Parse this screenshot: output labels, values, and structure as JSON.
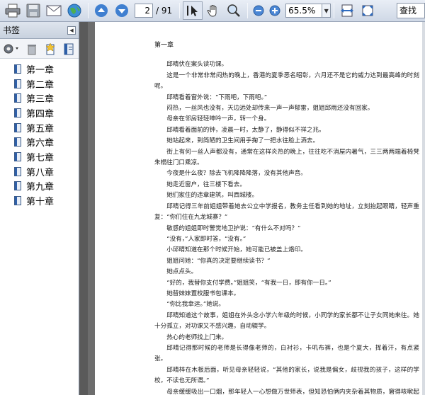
{
  "toolbar": {
    "page_current": "2",
    "page_total": "/ 91",
    "zoom": "65.5%",
    "search_label": "查找",
    "icons": [
      "printer-icon",
      "save-icon",
      "email-icon",
      "globe-icon",
      "page-up-icon",
      "page-down-icon",
      "select-tool-icon",
      "hand-tool-icon",
      "zoom-tool-icon",
      "zoom-out-icon",
      "zoom-in-icon",
      "fit-width-icon",
      "fit-page-icon"
    ]
  },
  "sidebar": {
    "title": "书签",
    "items": [
      {
        "label": "第一章"
      },
      {
        "label": "第二章"
      },
      {
        "label": "第三章"
      },
      {
        "label": "第四章"
      },
      {
        "label": "第五章"
      },
      {
        "label": "第六章"
      },
      {
        "label": "第七章"
      },
      {
        "label": "第八章"
      },
      {
        "label": "第九章"
      },
      {
        "label": "第十章"
      }
    ]
  },
  "document": {
    "chapter_title": "第一章",
    "paragraphs": [
      "邱晴伏在案头读功课。",
      "这是一个非常非常闷热的晚上，香港的夏季恶名昭彰，六月还不是它的威力达到最高峰的时刻呢。",
      "邱晴看着窗外说：“下雨吧，下雨吧。”",
      "闷热，一丝风也没有，天边远处却传来一声一声郁雷，姐姐邱雨还没有回家。",
      "母亲在邻房轻轻呻吟一声，转一个身。",
      "邱晴看着面前的钟，凌晨一时，太静了，静得似不祥之兆。",
      "她站起来，到简陋的卫生间用手掬了一把水往脸上洒去。",
      "街上有何一丝人声都没有，通常在这样炎热的晚上，往往吃不消屋内暑气，三三两两端着椅凳朱榻往门口乘凉。",
      "今夜是什么夜？除去飞机降降降落，没有其他声音。",
      "她走近窗户，往三楼下看去。",
      "她们家住的违章建筑，叫西城楼。",
      "邱晴记得三年前姐姐带着她去公立中学报名，教务主任看到她的地址，立刻抬起眼睛，轻声重复：“你们住在九龙城寨？”",
      "敏感的姐姐即时警觉地卫护说：“有什么不对吗？”",
      "“没有，”人家即时答，“没有。”",
      "小邱晴知道在那个时候开始，她可能已被盖上烙印。",
      "姐姐问她：“你真的决定要继续读书？”",
      "她点点头。",
      "“好的，我替你支付学费。”姐姐笑，“有我一日，即有你一日。”",
      "她替妹妹置校服书包课本。",
      "“你比我幸运。”她说。",
      "邱晴知道这个故事，姐姐在外头念小学六年级的时候，小同学的家长都不让子女同她来往。她十分孤立，对功课又不感兴趣，自动辍学。",
      "热心的老师找上门来。",
      "邱晴记得那时候的老师是长得像老师的，白衬衫，卡叽布裤，也是个夏大，挥着汗，有点紧张。",
      "邱晴梓在木板后面，听见母亲轻轻说，“其他的家长，说我是偏女，歧视我的孩子，这样的学校，不读也无所谓。”",
      "母亲缓缓吸出一口烟，那年轻人一心想做万世师表，但知恐怕俩内夹杂着其物质，窘得咳嗽起来。"
    ]
  }
}
